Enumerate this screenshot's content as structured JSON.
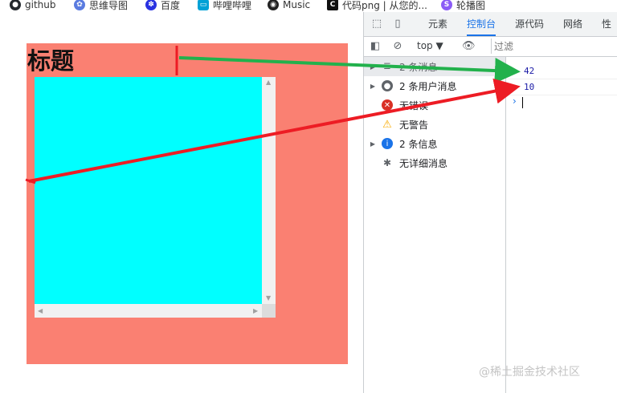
{
  "bookmarks": [
    {
      "label": "github",
      "icon": "github-icon"
    },
    {
      "label": "思维导图",
      "icon": "mindmap-icon"
    },
    {
      "label": "百度",
      "icon": "baidu-paw-icon"
    },
    {
      "label": "哔哩哔哩",
      "icon": "bilibili-icon"
    },
    {
      "label": "Music",
      "icon": "music-icon"
    },
    {
      "label": "代码png | 从您的...",
      "icon": "carbon-icon"
    },
    {
      "label": "轮播图",
      "icon": "slider-icon"
    }
  ],
  "page": {
    "title": "标题"
  },
  "devtools": {
    "tabs": [
      "元素",
      "控制台",
      "源代码",
      "网络",
      "性能"
    ],
    "active_tab": "控制台",
    "context_select": "top",
    "filter_placeholder": "过滤",
    "sidebar": [
      {
        "label": "2 条消息",
        "icon": "list-icon",
        "expandable": true
      },
      {
        "label": "2 条用户消息",
        "icon": "user-icon",
        "expandable": true
      },
      {
        "label": "无错误",
        "icon": "error-icon",
        "expandable": false
      },
      {
        "label": "无警告",
        "icon": "warning-icon",
        "expandable": false
      },
      {
        "label": "2 条信息",
        "icon": "info-icon",
        "expandable": true
      },
      {
        "label": "无详细消息",
        "icon": "bug-icon",
        "expandable": false
      }
    ],
    "console_output": [
      "42",
      "10"
    ],
    "prompt": "›"
  },
  "colors": {
    "box": "#fa8072",
    "inner": "#00ffff",
    "accent": "#1a73e8",
    "arrow_green": "#22b14c",
    "arrow_red": "#ed1c24"
  },
  "watermark": "@稀土掘金技术社区"
}
